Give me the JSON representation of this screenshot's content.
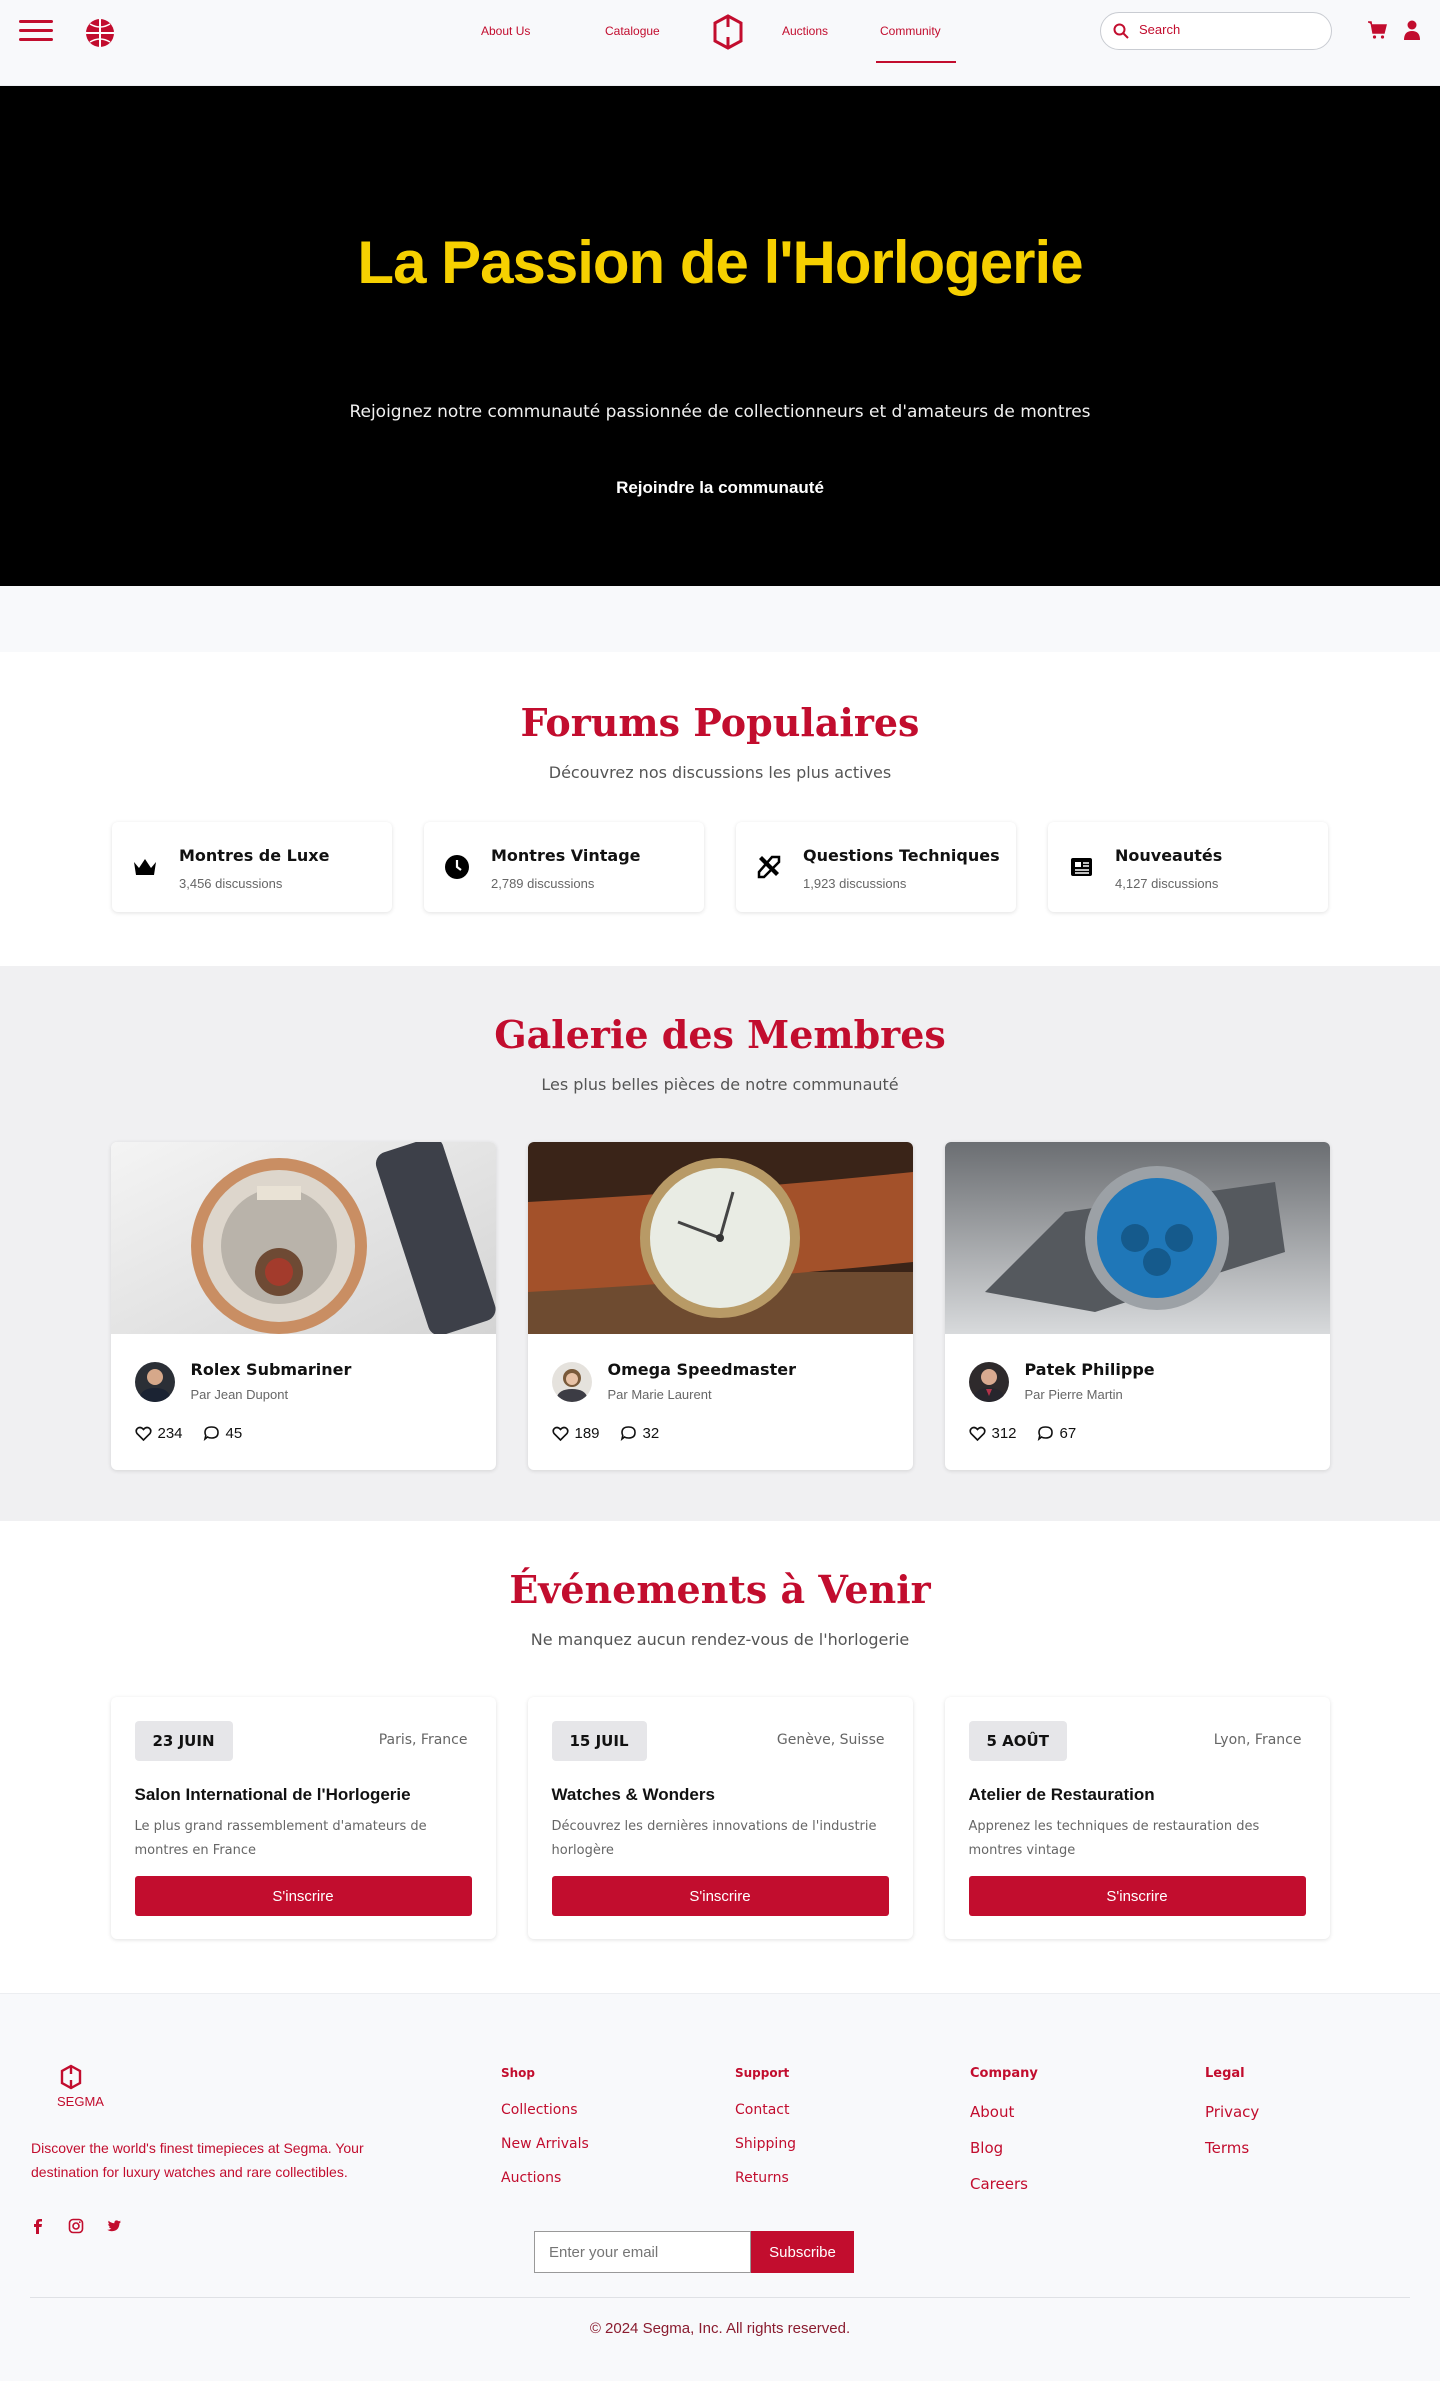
{
  "nav": {
    "links": [
      "About Us",
      "Catalogue",
      "Auctions",
      "Community"
    ],
    "active": "Community",
    "search_placeholder": "Search",
    "icons": [
      "menu-icon",
      "globe-icon",
      "logo-icon",
      "search-icon",
      "cart-icon",
      "user-icon"
    ]
  },
  "hero": {
    "title": "La Passion de l'Horlogerie",
    "subtitle": "Rejoignez notre communauté passionnée de collectionneurs et d'amateurs de montres",
    "cta": "Rejoindre la communauté"
  },
  "forums": {
    "title": "Forums Populaires",
    "subtitle": "Découvrez nos discussions les plus actives",
    "items": [
      {
        "title": "Montres de Luxe",
        "count": "3,456 discussions",
        "icon": "crown-icon"
      },
      {
        "title": "Montres Vintage",
        "count": "2,789 discussions",
        "icon": "clock-icon"
      },
      {
        "title": "Questions Techniques",
        "count": "1,923 discussions",
        "icon": "tools-icon"
      },
      {
        "title": "Nouveautés",
        "count": "4,127 discussions",
        "icon": "newspaper-icon"
      }
    ]
  },
  "gallery": {
    "title": "Galerie des Membres",
    "subtitle": "Les plus belles pièces de notre communauté",
    "items": [
      {
        "name": "Rolex Submariner",
        "author": "Par Jean Dupont",
        "likes": "234",
        "comments": "45"
      },
      {
        "name": "Omega Speedmaster",
        "author": "Par Marie Laurent",
        "likes": "189",
        "comments": "32"
      },
      {
        "name": "Patek Philippe",
        "author": "Par Pierre Martin",
        "likes": "312",
        "comments": "67"
      }
    ]
  },
  "events": {
    "title": "Événements à Venir",
    "subtitle": "Ne manquez aucun rendez-vous de l'horlogerie",
    "items": [
      {
        "date": "23 JUIN",
        "location": "Paris, France",
        "title": "Salon International de l'Horlogerie",
        "desc": "Le plus grand rassemblement d'amateurs de montres en France",
        "cta": "S'inscrire"
      },
      {
        "date": "15 JUIL",
        "location": "Genève, Suisse",
        "title": "Watches & Wonders",
        "desc": "Découvrez les dernières innovations de l'industrie horlogère",
        "cta": "S'inscrire"
      },
      {
        "date": "5 AOÛT",
        "location": "Lyon, France",
        "title": "Atelier de Restauration",
        "desc": "Apprenez les techniques de restauration des montres vintage",
        "cta": "S'inscrire"
      }
    ]
  },
  "footer": {
    "brand": "SEGMA",
    "description": "Discover the world's finest timepieces at Segma. Your destination for luxury watches and rare collectibles.",
    "social": [
      "facebook-icon",
      "instagram-icon",
      "twitter-icon"
    ],
    "columns": [
      {
        "title": "Shop",
        "links": [
          "Collections",
          "New Arrivals",
          "Auctions"
        ]
      },
      {
        "title": "Support",
        "links": [
          "Contact",
          "Shipping",
          "Returns"
        ]
      },
      {
        "title": "Company",
        "links": [
          "About",
          "Blog",
          "Careers"
        ]
      },
      {
        "title": "Legal",
        "links": [
          "Privacy",
          "Terms"
        ]
      }
    ],
    "email_placeholder": "Enter your email",
    "subscribe": "Subscribe",
    "copyright": "© 2024 Segma, Inc. All rights reserved."
  },
  "colors": {
    "brand": "#c20d2e",
    "hero_title": "#f6d000",
    "hero_bg": "#000000"
  }
}
